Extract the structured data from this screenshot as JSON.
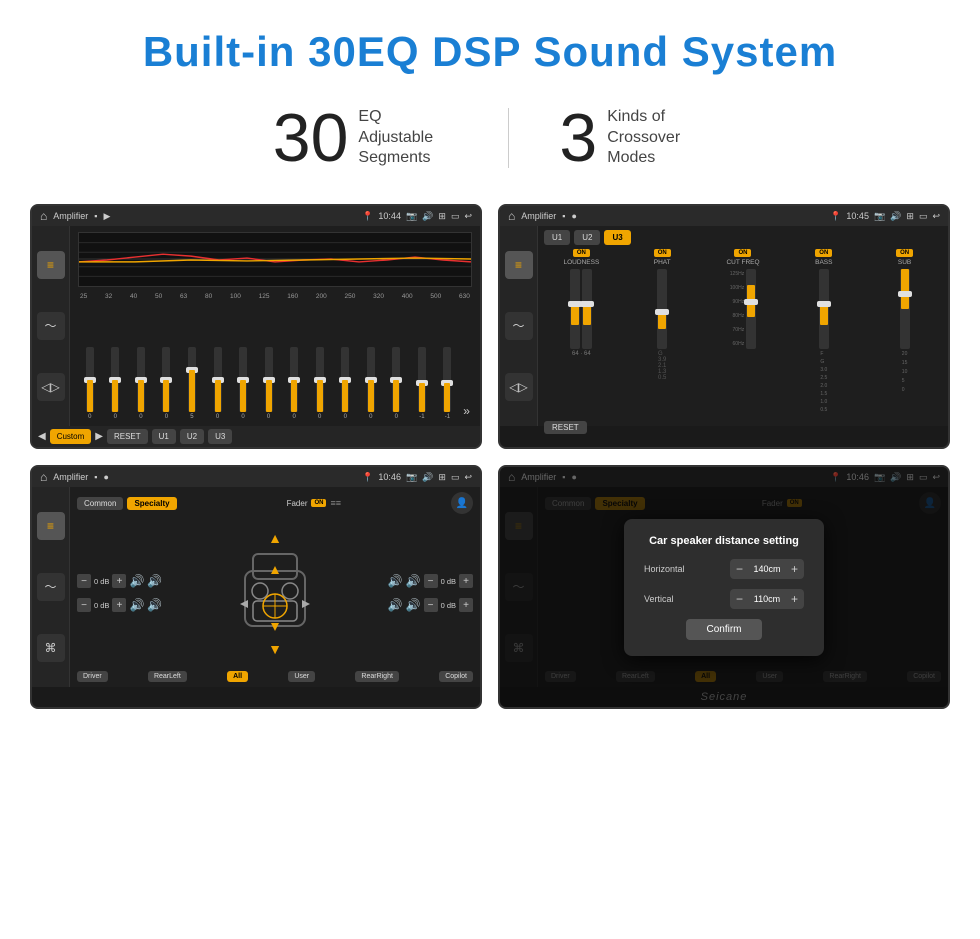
{
  "header": {
    "title": "Built-in 30EQ DSP Sound System",
    "accent_color": "#1a7fd4"
  },
  "stats": [
    {
      "number": "30",
      "label": "EQ Adjustable\nSegments"
    },
    {
      "number": "3",
      "label": "Kinds of\nCrossover Modes"
    }
  ],
  "screens": [
    {
      "id": "screen-eq",
      "statusbar": {
        "app": "Amplifier",
        "time": "10:44"
      },
      "type": "equalizer",
      "freqs": [
        "25",
        "32",
        "40",
        "50",
        "63",
        "80",
        "100",
        "125",
        "160",
        "200",
        "250",
        "320",
        "400",
        "500",
        "630"
      ],
      "values": [
        "0",
        "0",
        "0",
        "0",
        "5",
        "0",
        "0",
        "0",
        "0",
        "0",
        "0",
        "0",
        "0",
        "-1",
        "0",
        "-1"
      ],
      "bottomBtns": [
        "Custom",
        "RESET",
        "U1",
        "U2",
        "U3"
      ]
    },
    {
      "id": "screen-crossover",
      "statusbar": {
        "app": "Amplifier",
        "time": "10:45"
      },
      "type": "crossover",
      "presets": [
        "U1",
        "U2",
        "U3"
      ],
      "activePreset": "U3",
      "bands": [
        {
          "label": "LOUDNESS",
          "on": true
        },
        {
          "label": "PHAT",
          "on": true
        },
        {
          "label": "CUT FREQ",
          "on": true
        },
        {
          "label": "BASS",
          "on": true
        },
        {
          "label": "SUB",
          "on": true
        }
      ],
      "resetBtn": "RESET"
    },
    {
      "id": "screen-speaker",
      "statusbar": {
        "app": "Amplifier",
        "time": "10:46"
      },
      "type": "speaker",
      "presets": [
        "Common",
        "Specialty"
      ],
      "activePreset": "Specialty",
      "faderLabel": "Fader",
      "faderOn": true,
      "channels": [
        {
          "position": "top-left",
          "db": "0 dB"
        },
        {
          "position": "top-right",
          "db": "0 dB"
        },
        {
          "position": "bottom-left",
          "db": "0 dB"
        },
        {
          "position": "bottom-right",
          "db": "0 dB"
        }
      ],
      "positionBtns": [
        "Driver",
        "RearLeft",
        "All",
        "User",
        "RearRight",
        "Copilot"
      ]
    },
    {
      "id": "screen-dialog",
      "statusbar": {
        "app": "Amplifier",
        "time": "10:46"
      },
      "type": "speaker-dialog",
      "presets": [
        "Common",
        "Specialty"
      ],
      "activePreset": "Specialty",
      "dialog": {
        "title": "Car speaker distance setting",
        "horizontal": {
          "label": "Horizontal",
          "value": "140cm"
        },
        "vertical": {
          "label": "Vertical",
          "value": "110cm"
        },
        "confirmBtn": "Confirm"
      }
    }
  ]
}
